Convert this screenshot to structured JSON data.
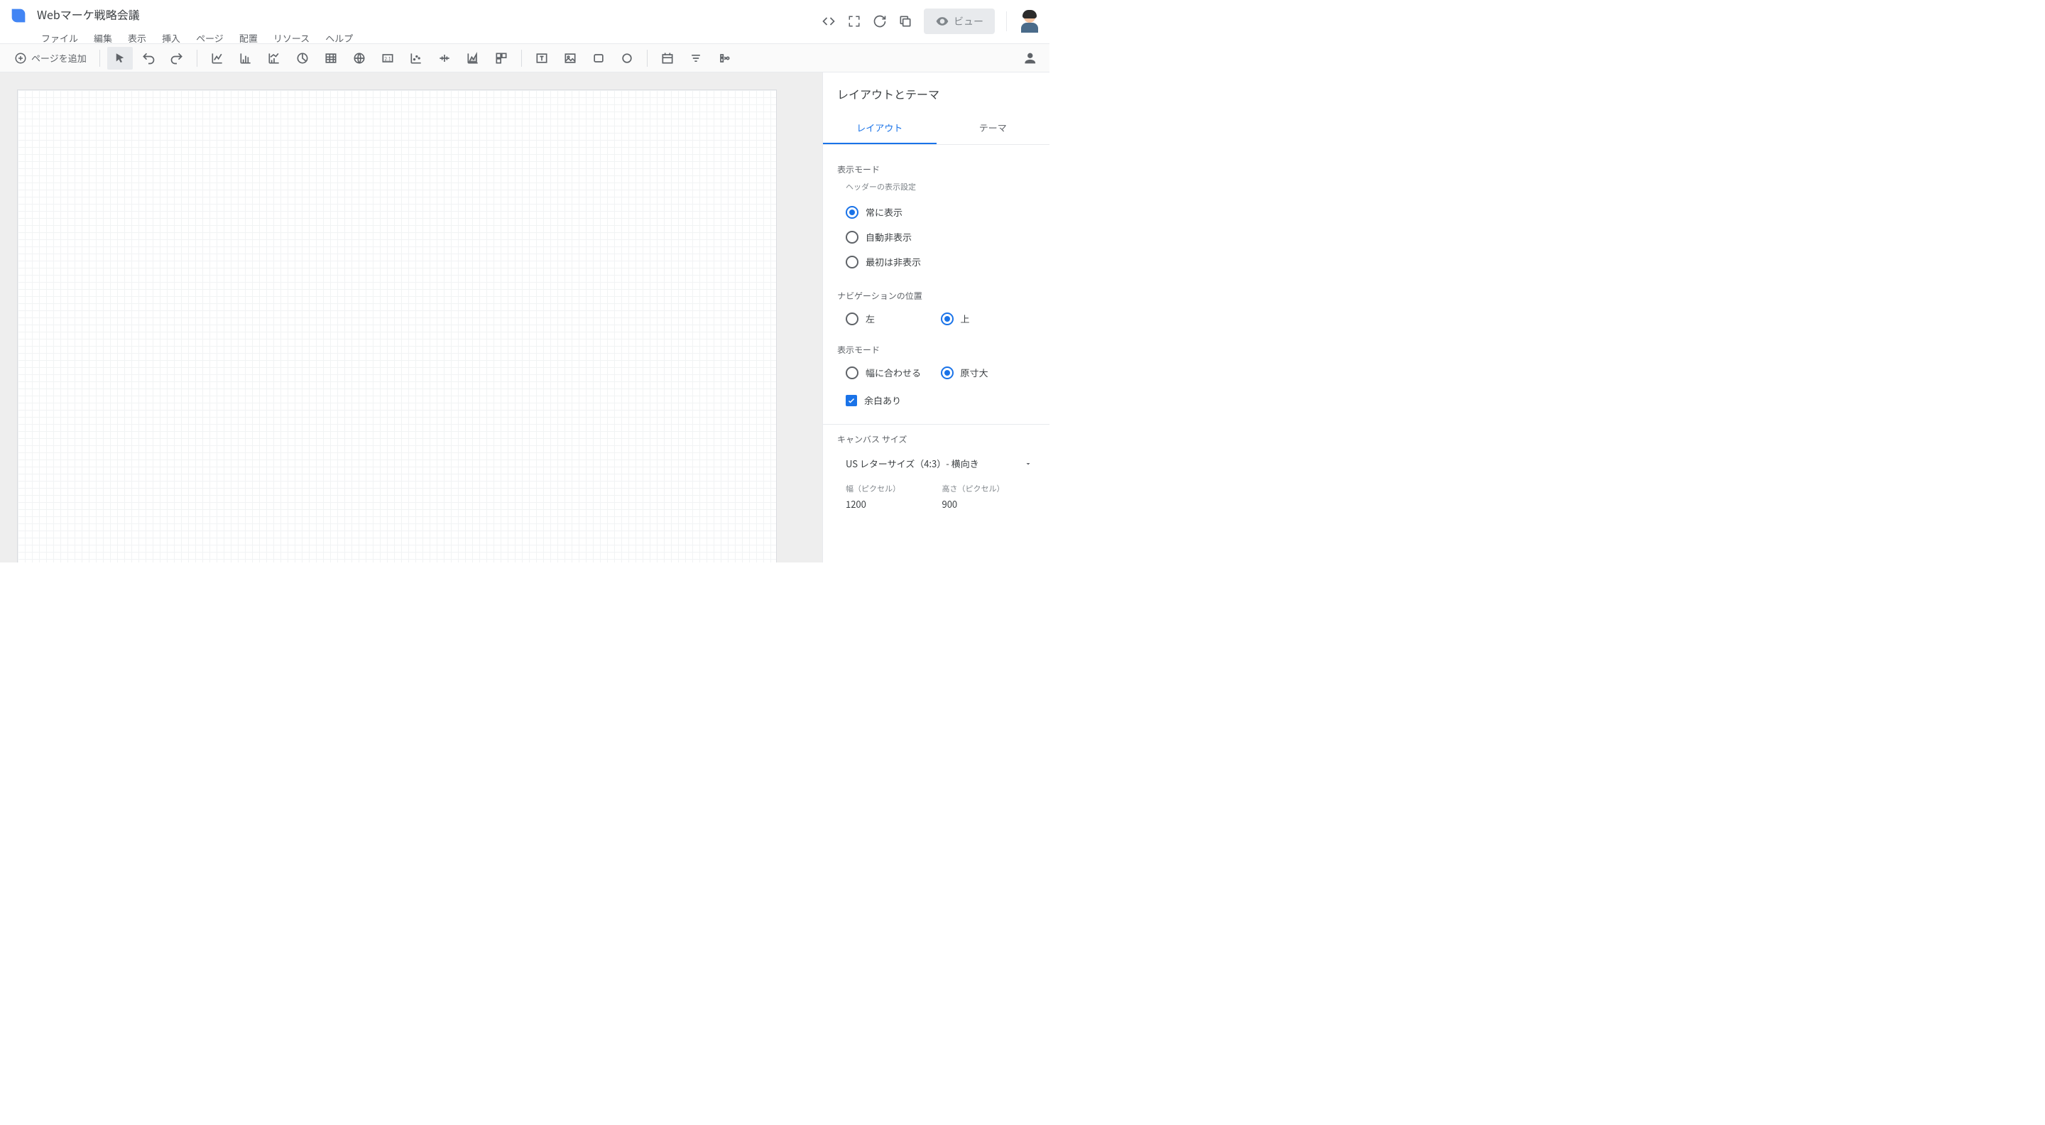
{
  "header": {
    "doc_title": "Webマーケ戦略会議",
    "menus": [
      "ファイル",
      "編集",
      "表示",
      "挿入",
      "ページ",
      "配置",
      "リソース",
      "ヘルプ"
    ],
    "view_btn_label": "ビュー"
  },
  "toolbar": {
    "add_page_label": "ページを追加"
  },
  "sidepanel": {
    "title": "レイアウトとテーマ",
    "tabs": [
      "レイアウト",
      "テーマ"
    ],
    "active_tab": 0,
    "sections": {
      "display_mode_label": "表示モード",
      "header_display_label": "ヘッダーの表示設定",
      "header_display_options": [
        "常に表示",
        "自動非表示",
        "最初は非表示"
      ],
      "header_display_selected": 0,
      "nav_position_label": "ナビゲーションの位置",
      "nav_position_options": [
        "左",
        "上"
      ],
      "nav_position_selected": 1,
      "display_mode2_label": "表示モード",
      "display_mode2_options": [
        "幅に合わせる",
        "原寸大"
      ],
      "display_mode2_selected": 1,
      "margin_checkbox_label": "余白あり",
      "margin_checked": true,
      "canvas_size_label": "キャンバス サイズ",
      "canvas_size_value": "US レターサイズ（4:3）- 横向き",
      "width_label": "幅（ピクセル）",
      "width_value": "1200",
      "height_label": "高さ（ピクセル）",
      "height_value": "900"
    }
  }
}
